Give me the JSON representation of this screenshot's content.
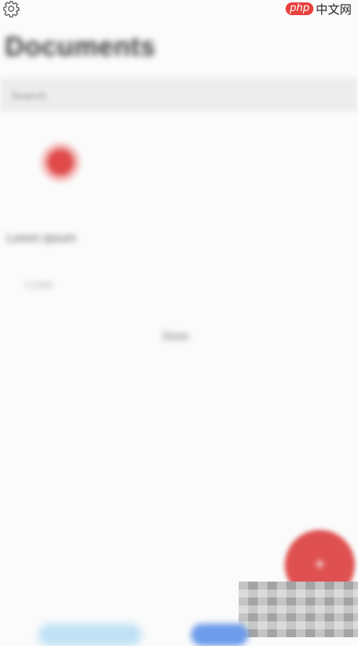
{
  "header": {
    "settings_icon": "gear-icon",
    "title": "Documents"
  },
  "watermark": {
    "badge": "php",
    "text": "中文网"
  },
  "search": {
    "placeholder": "Search"
  },
  "document": {
    "icon": "pdf-document-icon",
    "name": "Lorem Ipsum",
    "meta": "1 page"
  },
  "center_label": "Done",
  "fab": {
    "icon": "add-icon"
  },
  "colors": {
    "accent": "#df5151",
    "background": "#fbfbfb",
    "tab_blue": "#6b9bea"
  }
}
